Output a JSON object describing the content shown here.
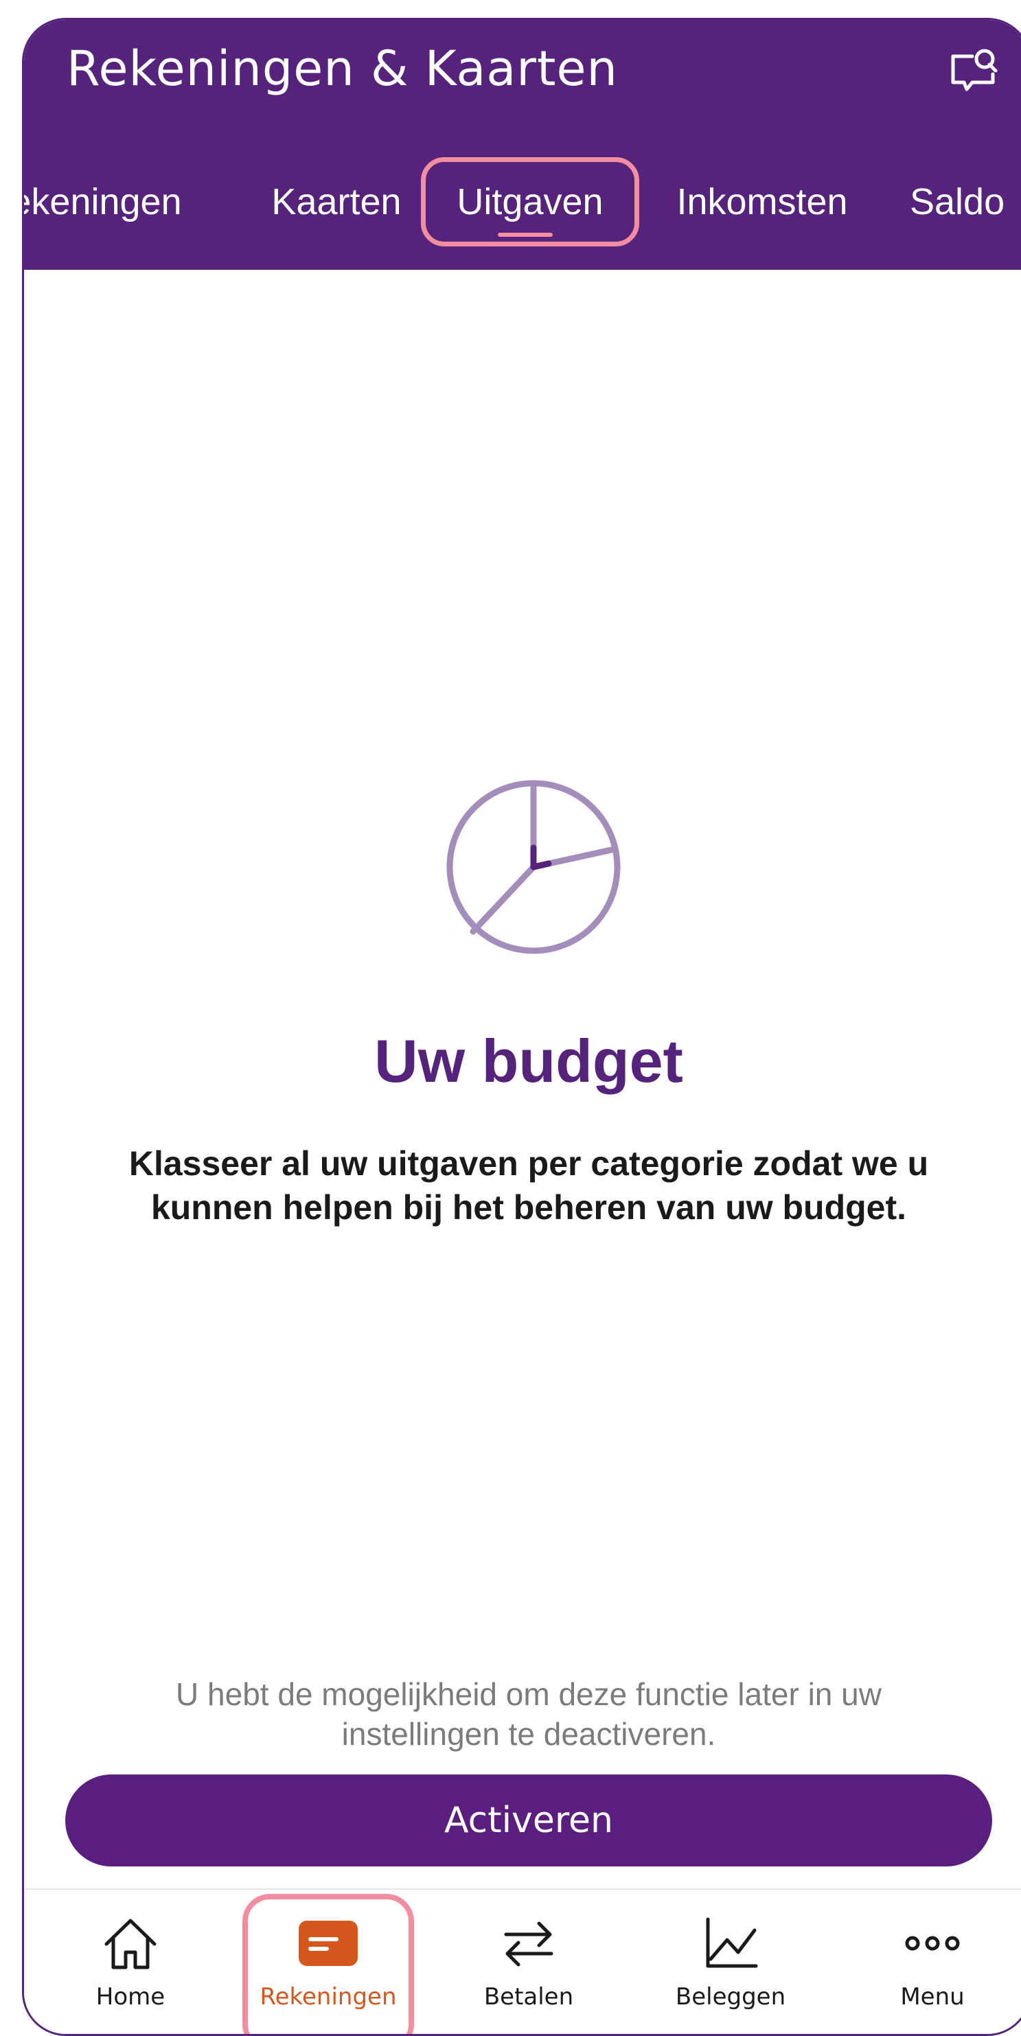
{
  "header": {
    "title": "Rekeningen & Kaarten",
    "tabs": [
      {
        "label": "ekeningen",
        "active": false
      },
      {
        "label": "Kaarten",
        "active": false
      },
      {
        "label": "Uitgaven",
        "active": true
      },
      {
        "label": "Inkomsten",
        "active": false
      },
      {
        "label": "Saldo",
        "active": false
      }
    ]
  },
  "main": {
    "icon": "pie-chart-icon",
    "title": "Uw budget",
    "description": "Klasseer al uw uitgaven per categorie zodat we u kunnen helpen bij het beheren van uw budget.",
    "hint": "U hebt de mogelijkheid om deze functie later in uw instellingen te deactiveren.",
    "activate_label": "Activeren"
  },
  "bottom_nav": {
    "items": [
      {
        "label": "Home",
        "icon": "home-icon",
        "active": false
      },
      {
        "label": "Rekeningen",
        "icon": "card-icon",
        "active": true
      },
      {
        "label": "Betalen",
        "icon": "transfer-arrows-icon",
        "active": false
      },
      {
        "label": "Beleggen",
        "icon": "line-chart-icon",
        "active": false
      },
      {
        "label": "Menu",
        "icon": "more-dots-icon",
        "active": false
      }
    ]
  },
  "colors": {
    "brand_purple": "#55237c",
    "accent_orange": "#d5571d",
    "highlight_pink": "#f28ea0",
    "icon_lavender": "#a48cbb"
  }
}
